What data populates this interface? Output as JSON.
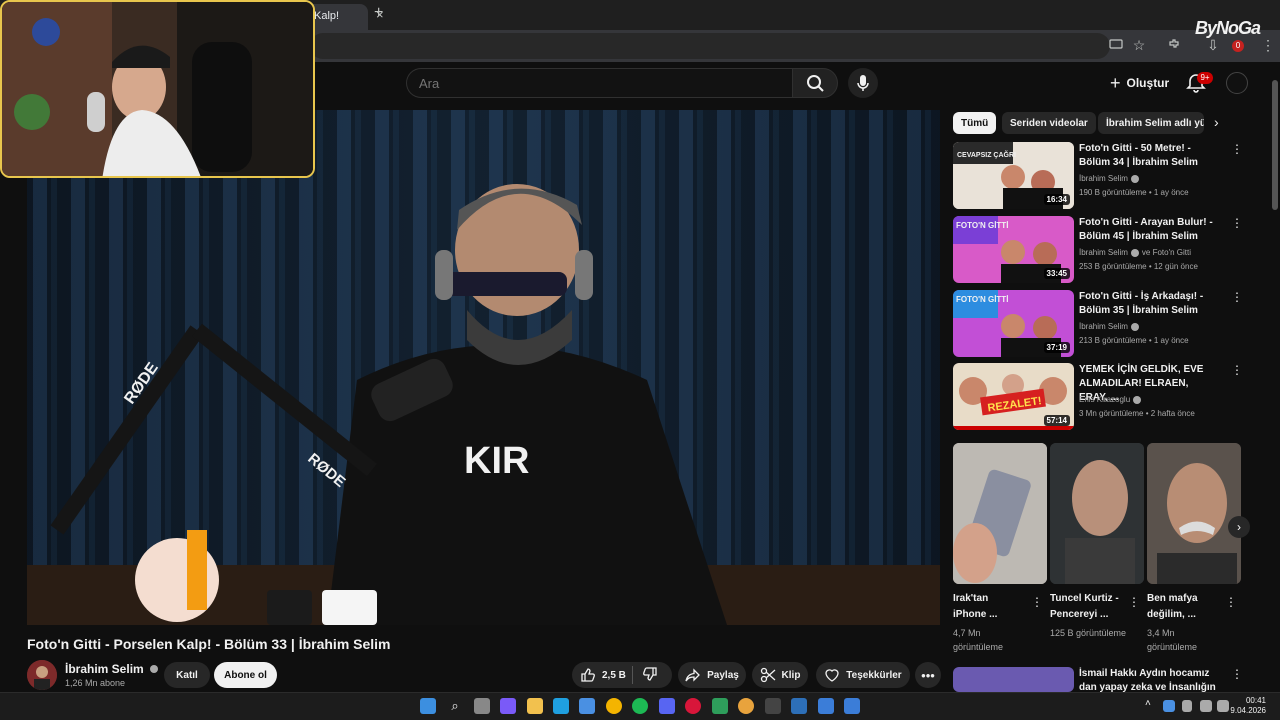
{
  "browser": {
    "tab_title": "Kalp!",
    "tab_close": "×",
    "new_tab": "+",
    "overlay_watermark": "ByNoGa"
  },
  "youtube_header": {
    "search_placeholder": "Ara",
    "create_label": "Oluştur",
    "notifications_badge": "9+"
  },
  "video": {
    "title": "Foto'n Gitti - Porselen Kalp! - Bölüm 33 | İbrahim Selim",
    "channel_name": "İbrahim Selim",
    "channel_subs": "1,26 Mn abone",
    "join_label": "Katıl",
    "subscribe_label": "Abone ol",
    "like_count": "2,5 B",
    "share_label": "Paylaş",
    "clip_label": "Klip",
    "thanks_label": "Teşekkürler",
    "more_label": "•••"
  },
  "video_overlay": {
    "shirt_text": "KIR",
    "mic_brand": "RØDE"
  },
  "chips": [
    "Tümü",
    "Seriden videolar",
    "İbrahim Selim adlı yük"
  ],
  "recommendations": [
    {
      "title": "Foto'n Gitti - 50 Metre! - Bölüm 34 | İbrahim Selim",
      "channel": "İbrahim Selim",
      "channel_extra": "",
      "meta": "190 B görüntüleme • 1 ay önce",
      "duration": "16:34",
      "thumb_color": "#e9e2d8",
      "thumb_text": "CEVAPSIZ ÇAĞRI"
    },
    {
      "title": "Foto'n Gitti - Arayan Bulur! - Bölüm 45 | İbrahim Selim",
      "channel": "İbrahim Selim",
      "channel_extra": "ve Foto'n Gitti",
      "meta": "253 B görüntüleme • 12 gün önce",
      "duration": "33:45",
      "thumb_color": "#d85ac8",
      "thumb_text": "FOTO'N GİTTİ"
    },
    {
      "title": "Foto'n Gitti - İş Arkadaşı! - Bölüm 35 | İbrahim Selim",
      "channel": "İbrahim Selim",
      "channel_extra": "",
      "meta": "213 B görüntüleme • 1 ay önce",
      "duration": "37:19",
      "thumb_color": "#c24fd6",
      "thumb_text": "FOTO'N GİTTİ"
    },
    {
      "title": "YEMEK İÇİN GELDİK, EVE ALMADILAR! ELRAEN, ERAY, ...",
      "channel": "Enis Kirazoglu",
      "channel_extra": "",
      "meta": "3 Mn görüntüleme • 2 hafta önce",
      "duration": "57:14",
      "thumb_color": "#e8dcc8",
      "thumb_text": "REZALET!"
    }
  ],
  "shorts": [
    {
      "title": "Irak'tan iPhone ...",
      "views": "4,7 Mn görüntüleme",
      "color": "#c9c6c0"
    },
    {
      "title": "Tuncel Kurtiz - Pencereyi ...",
      "views": "125 B görüntüleme",
      "color": "#3a3c3e"
    },
    {
      "title": "Ben mafya değilim, ...",
      "views": "3,4 Mn görüntüleme",
      "color": "#4a4440"
    }
  ],
  "next_rec": {
    "title": "İsmail Hakkı Aydın hocamız dan yapay zeka ve İnsanlığın ..."
  },
  "taskbar": {
    "time": "00:41",
    "date": "9.04.2026"
  },
  "colors": {
    "accent": "#f1f1f1",
    "badge_red": "#cc0000",
    "webcam_border": "#e8c64d",
    "bg": "#0f0f0f"
  }
}
